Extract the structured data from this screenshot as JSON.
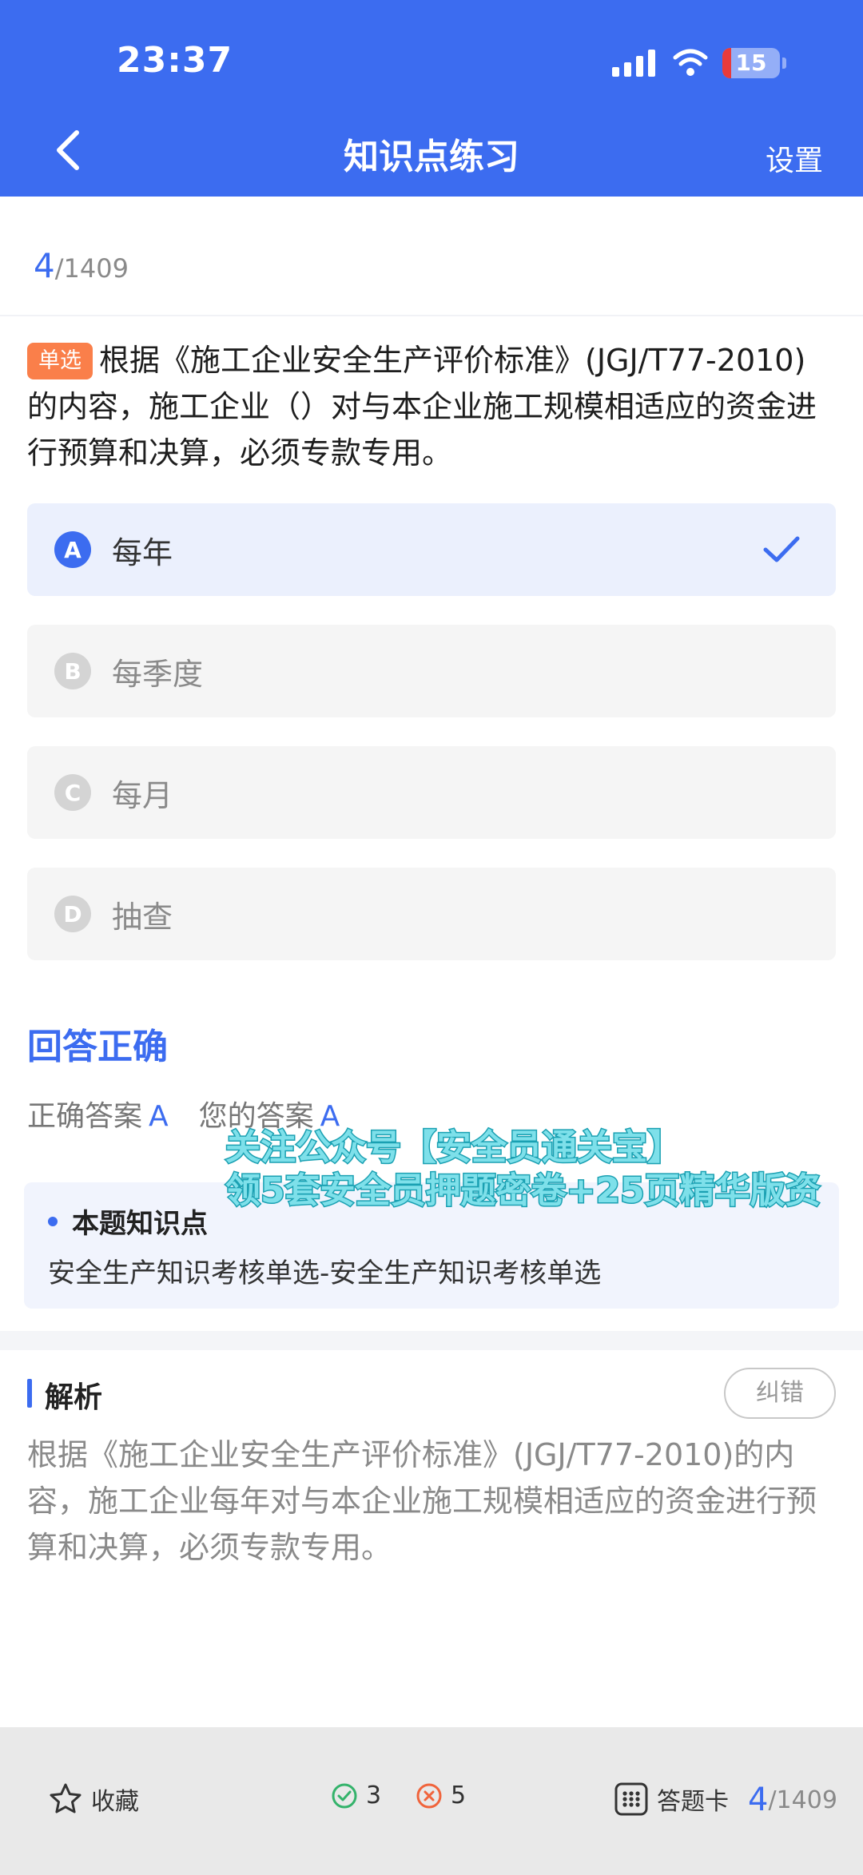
{
  "status": {
    "time": "23:37",
    "battery": "15",
    "battery_fraction": 0.15
  },
  "nav": {
    "title": "知识点练习",
    "settings": "设置"
  },
  "progress": {
    "current": "4",
    "total": "/1409"
  },
  "question": {
    "type_tag": "单选",
    "text": "根据《施工企业安全生产评价标准》(JGJ/T77-2010)的内容，施工企业（）对与本企业施工规模相适应的资金进行预算和决算，必须专款专用。"
  },
  "options": [
    {
      "letter": "A",
      "text": "每年",
      "selected": true
    },
    {
      "letter": "B",
      "text": "每季度",
      "selected": false
    },
    {
      "letter": "C",
      "text": "每月",
      "selected": false
    },
    {
      "letter": "D",
      "text": "抽查",
      "selected": false
    }
  ],
  "result": {
    "status": "回答正确",
    "correct_label": "正确答案",
    "correct_value": "A",
    "your_label": "您的答案",
    "your_value": "A"
  },
  "watermark": {
    "line1": "关注公众号【安全员通关宝】",
    "line2": "领5套安全员押题密卷+25页精华版资"
  },
  "knowledge_point": {
    "title": "本题知识点",
    "text": "安全生产知识考核单选-安全生产知识考核单选"
  },
  "analysis": {
    "title": "解析",
    "report_label": "纠错",
    "text": "根据《施工企业安全生产评价标准》(JGJ/T77-2010)的内容，施工企业每年对与本企业施工规模相适应的资金进行预算和决算，必须专款专用。"
  },
  "bottom": {
    "favorite_label": "收藏",
    "correct_count": "3",
    "wrong_count": "5",
    "answer_card_label": "答题卡",
    "current": "4",
    "total": "/1409"
  },
  "colors": {
    "primary": "#3c6cf0",
    "tag_orange": "#fa7f4a",
    "correct_green": "#34b36b",
    "wrong_orange": "#f0643c"
  }
}
